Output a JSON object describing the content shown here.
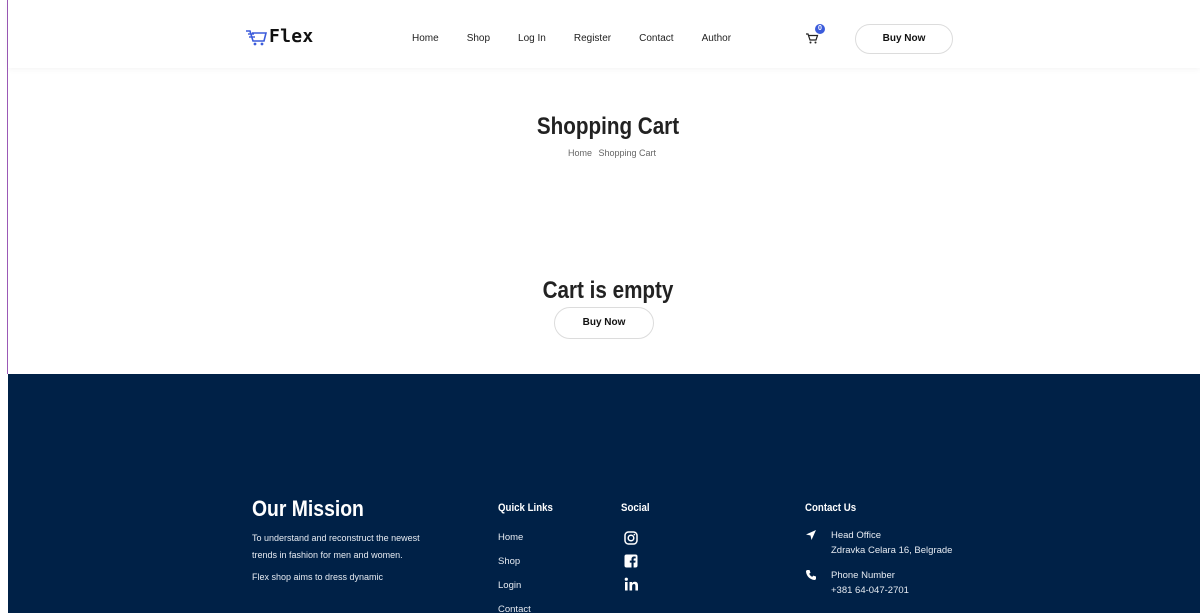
{
  "header": {
    "logo_text": "Flex",
    "nav": [
      "Home",
      "Shop",
      "Log In",
      "Register",
      "Contact",
      "Author"
    ],
    "cart_count": "0",
    "buy_label": "Buy Now"
  },
  "hero": {
    "title": "Shopping Cart",
    "breadcrumb": [
      "Home",
      "Shopping Cart"
    ]
  },
  "cart": {
    "empty_message": "Cart is empty",
    "buy_label": "Buy Now"
  },
  "footer": {
    "mission": {
      "title": "Our Mission",
      "text1": "To understand and reconstruct the newest trends in fashion for men and women.",
      "text2": "Flex shop aims to dress dynamic"
    },
    "quick_links": {
      "title": "Quick Links",
      "items": [
        "Home",
        "Shop",
        "Login",
        "Contact"
      ]
    },
    "social": {
      "title": "Social",
      "icons": [
        "instagram-icon",
        "facebook-icon",
        "linkedin-icon"
      ]
    },
    "contact": {
      "title": "Contact Us",
      "office_label": "Head Office",
      "office_value": "Zdravka Celara 16, Belgrade",
      "phone_label": "Phone Number",
      "phone_value": "+381 64-047-2701"
    },
    "bg_color": "#002147"
  },
  "colors": {
    "badge": "#3b5bdb",
    "logo_icon": "#3b5bdb"
  }
}
